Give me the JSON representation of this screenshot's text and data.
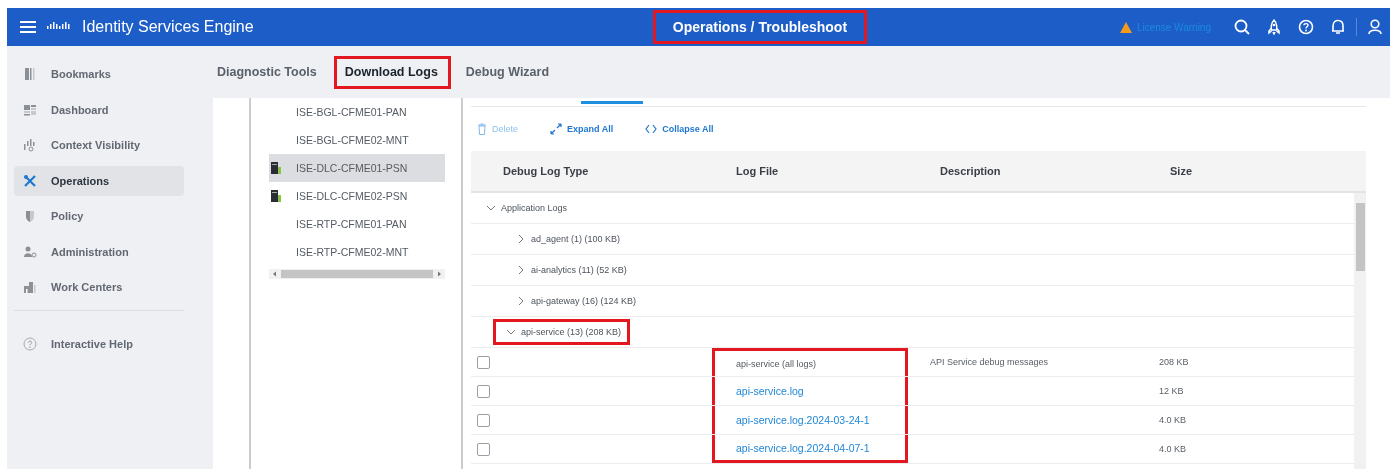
{
  "header": {
    "app_title": "Identity Services Engine",
    "page_title": "Operations / Troubleshoot",
    "page_title_highlighted": true,
    "license_warning": "License Warning"
  },
  "sidebar": {
    "items": [
      {
        "label": "Bookmarks",
        "kind": "bookmarks",
        "selected": false
      },
      {
        "label": "Dashboard",
        "kind": "dashboard",
        "selected": false
      },
      {
        "label": "Context Visibility",
        "kind": "context",
        "selected": false
      },
      {
        "label": "Operations",
        "kind": "operations",
        "selected": true
      },
      {
        "label": "Policy",
        "kind": "policy",
        "selected": false
      },
      {
        "label": "Administration",
        "kind": "admin",
        "selected": false
      },
      {
        "label": "Work Centers",
        "kind": "workcenters",
        "selected": false
      }
    ],
    "help": "Interactive Help"
  },
  "tabs": [
    {
      "label": "Diagnostic Tools",
      "selected": false,
      "highlighted": false
    },
    {
      "label": "Download Logs",
      "selected": true,
      "highlighted": true
    },
    {
      "label": "Debug Wizard",
      "selected": false,
      "highlighted": false
    }
  ],
  "nodes": [
    {
      "label": "ISE-BGL-CFME01-PAN",
      "server_icon": false,
      "selected": false
    },
    {
      "label": "ISE-BGL-CFME02-MNT",
      "server_icon": false,
      "selected": false
    },
    {
      "label": "ISE-DLC-CFME01-PSN",
      "server_icon": true,
      "selected": true
    },
    {
      "label": "ISE-DLC-CFME02-PSN",
      "server_icon": true,
      "selected": false
    },
    {
      "label": "ISE-RTP-CFME01-PAN",
      "server_icon": false,
      "selected": false
    },
    {
      "label": "ISE-RTP-CFME02-MNT",
      "server_icon": false,
      "selected": false
    }
  ],
  "toolbar": [
    {
      "label": "Delete",
      "kind": "delete",
      "disabled": true
    },
    {
      "label": "Expand All",
      "kind": "expand",
      "disabled": false
    },
    {
      "label": "Collapse All",
      "kind": "collapse",
      "disabled": false
    }
  ],
  "table": {
    "columns": [
      "Debug Log Type",
      "Log File",
      "Description",
      "Size"
    ],
    "rows": [
      {
        "kind": "group",
        "label": "Application Logs",
        "expanded": true,
        "highlighted": false,
        "children": [
          {
            "kind": "group",
            "label": "ad_agent (1) (100 KB)",
            "expanded": false,
            "highlighted": false
          },
          {
            "kind": "group",
            "label": "ai-analytics (11) (52 KB)",
            "expanded": false,
            "highlighted": false
          },
          {
            "kind": "group",
            "label": "api-gateway (16) (124 KB)",
            "expanded": false,
            "highlighted": false
          },
          {
            "kind": "group",
            "label": "api-service (13) (208 KB)",
            "expanded": true,
            "highlighted": true,
            "children": [
              {
                "kind": "file",
                "checked": false,
                "log_file": "api-service (all logs)",
                "link": false,
                "description": "API Service debug messages",
                "size": "208 KB",
                "highlighted": true
              },
              {
                "kind": "file",
                "checked": false,
                "log_file": "api-service.log",
                "link": true,
                "size": "12 KB",
                "highlighted": true
              },
              {
                "kind": "file",
                "checked": false,
                "log_file": "api-service.log.2024-03-24-1",
                "link": true,
                "size": "4.0 KB",
                "highlighted": true
              },
              {
                "kind": "file",
                "checked": false,
                "log_file": "api-service.log.2024-04-07-1",
                "link": true,
                "size": "4.0 KB",
                "highlighted": true
              }
            ]
          }
        ]
      }
    ]
  }
}
